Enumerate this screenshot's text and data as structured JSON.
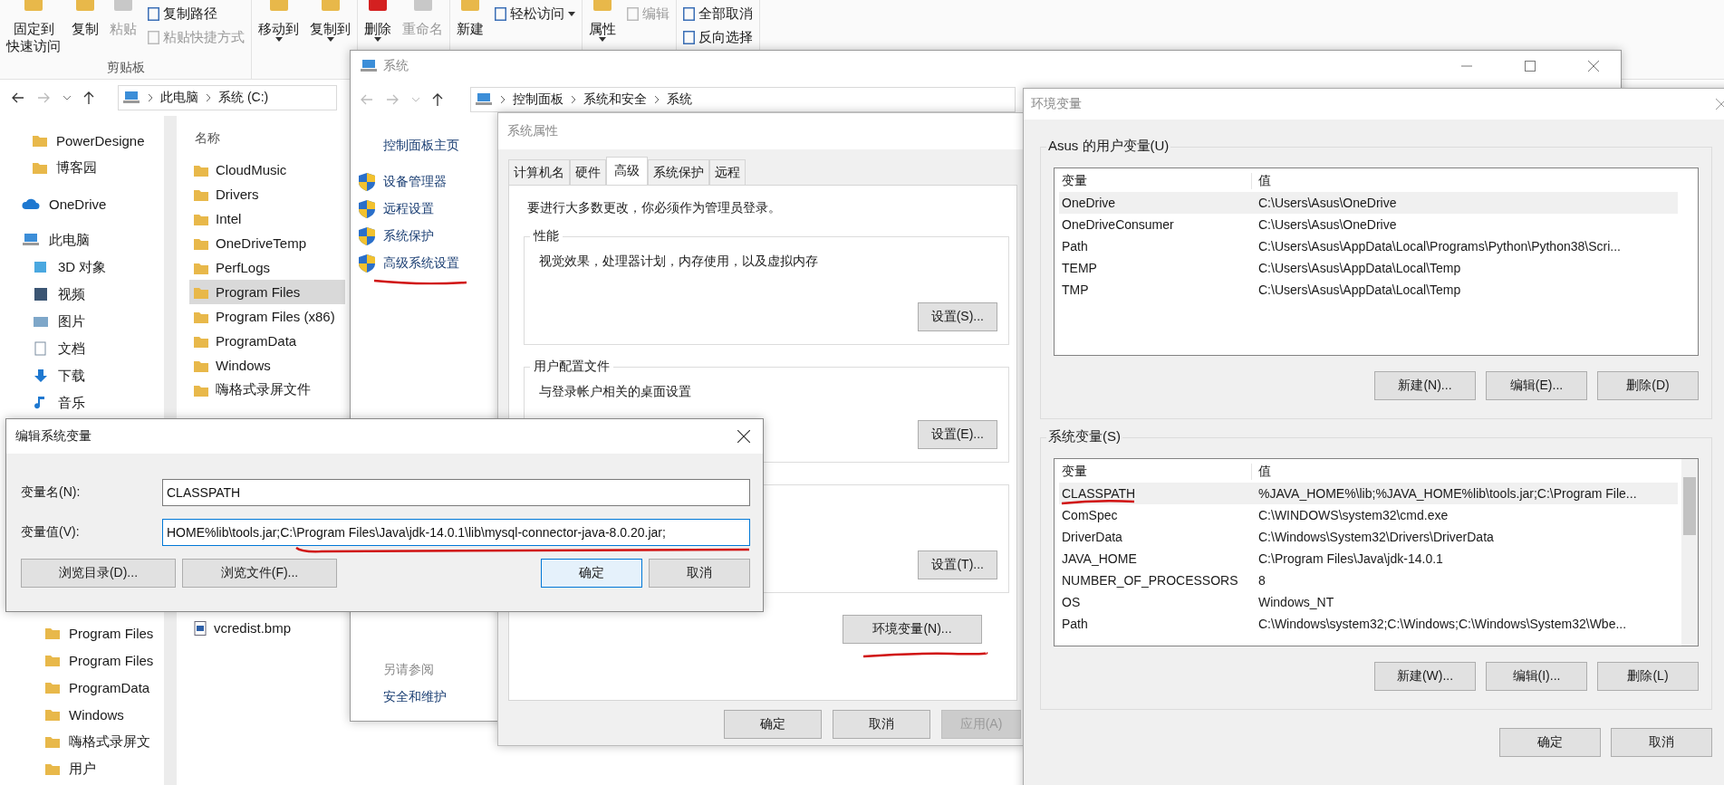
{
  "explorer": {
    "ribbon": {
      "groups": [
        {
          "label": "剪贴板",
          "items": [
            {
              "kind": "large",
              "lines": [
                "固定到",
                "快速访问"
              ],
              "disabled": false,
              "dropdown": false
            },
            {
              "kind": "large",
              "lines": [
                "复制"
              ],
              "disabled": false,
              "dropdown": false
            },
            {
              "kind": "large",
              "lines": [
                "粘贴"
              ],
              "disabled": true,
              "dropdown": false
            },
            {
              "kind": "small",
              "lines": [
                "复制路径"
              ],
              "disabled": false,
              "dropdown": false
            },
            {
              "kind": "small",
              "lines": [
                "粘贴快捷方式"
              ],
              "disabled": true,
              "dropdown": false
            }
          ]
        },
        {
          "items": [
            {
              "kind": "large",
              "lines": [
                "移动到"
              ],
              "disabled": false,
              "dropdown": true
            },
            {
              "kind": "large",
              "lines": [
                "复制到"
              ],
              "disabled": false,
              "dropdown": true
            }
          ]
        },
        {
          "items": [
            {
              "kind": "large",
              "lines": [
                "删除"
              ],
              "disabled": false,
              "dropdown": true
            },
            {
              "kind": "large",
              "lines": [
                "重命名"
              ],
              "disabled": true,
              "dropdown": false
            }
          ]
        },
        {
          "items": [
            {
              "kind": "large",
              "lines": [
                "新建"
              ],
              "disabled": false,
              "dropdown": false
            },
            {
              "kind": "small",
              "lines": [
                "轻松访问"
              ],
              "disabled": false,
              "dropdown": true
            }
          ]
        },
        {
          "items": [
            {
              "kind": "large",
              "lines": [
                "属性"
              ],
              "disabled": false,
              "dropdown": true
            },
            {
              "kind": "small",
              "lines": [
                "编辑"
              ],
              "disabled": true,
              "dropdown": false
            }
          ]
        },
        {
          "items": [
            {
              "kind": "small",
              "lines": [
                "全部取消"
              ],
              "disabled": false,
              "dropdown": false
            },
            {
              "kind": "small",
              "lines": [
                "反向选择"
              ],
              "disabled": false,
              "dropdown": false
            }
          ]
        }
      ]
    },
    "address": [
      "此电脑",
      "系统 (C:)"
    ],
    "quick_access": [
      "PowerDesigne",
      "博客园"
    ],
    "onedrive": "OneDrive",
    "this_pc": {
      "label": "此电脑",
      "children": [
        "3D 对象",
        "视频",
        "图片",
        "文档",
        "下载",
        "音乐"
      ]
    },
    "drive_folders": [
      "Program Files",
      "Program Files",
      "ProgramData",
      "Windows",
      "嗨格式录屏文",
      "用户"
    ],
    "column_header": "名称",
    "files_top": [
      {
        "label": "CloudMusic",
        "selected": false
      },
      {
        "label": "Drivers",
        "selected": false
      },
      {
        "label": "Intel",
        "selected": false
      },
      {
        "label": "OneDriveTemp",
        "selected": false
      },
      {
        "label": "PerfLogs",
        "selected": false
      },
      {
        "label": "Program Files",
        "selected": true
      },
      {
        "label": "Program Files (x86)",
        "selected": false
      },
      {
        "label": "ProgramData",
        "selected": false
      },
      {
        "label": "Windows",
        "selected": false
      },
      {
        "label": "嗨格式录屏文件",
        "selected": false
      }
    ],
    "files_bottom": [
      {
        "label": "vcredist.bmp",
        "selected": false
      }
    ]
  },
  "system_window": {
    "title": "系统",
    "address": [
      "控制面板",
      "系统和安全",
      "系统"
    ],
    "home_link": "控制面板主页",
    "tasks": [
      "设备管理器",
      "远程设置",
      "系统保护",
      "高级系统设置"
    ],
    "see_also": {
      "heading": "另请参阅",
      "links": [
        "安全和维护"
      ]
    }
  },
  "system_properties": {
    "title": "系统属性",
    "tabs": [
      {
        "label": "计算机名",
        "selected": false
      },
      {
        "label": "硬件",
        "selected": false
      },
      {
        "label": "高级",
        "selected": true
      },
      {
        "label": "系统保护",
        "selected": false
      },
      {
        "label": "远程",
        "selected": false
      }
    ],
    "notice": "要进行大多数更改，你必须作为管理员登录。",
    "groups": [
      {
        "title": "性能",
        "description": "视觉效果，处理器计划，内存使用，以及虚拟内存",
        "button": "设置(S)..."
      },
      {
        "title": "用户配置文件",
        "description": "与登录帐户相关的桌面设置",
        "button": "设置(E)..."
      },
      {
        "button": "设置(T)..."
      }
    ],
    "env_button": "环境变量(N)...",
    "buttons": [
      {
        "label": "确定",
        "disabled": false
      },
      {
        "label": "取消",
        "disabled": false
      },
      {
        "label": "应用(A)",
        "disabled": true
      }
    ]
  },
  "env_window": {
    "title": "环境变量",
    "user_vars": {
      "title": "Asus 的用户变量(U)",
      "columns": [
        "变量",
        "值"
      ],
      "rows": [
        {
          "name": "OneDrive",
          "value": "C:\\Users\\Asus\\OneDrive",
          "selected": true
        },
        {
          "name": "OneDriveConsumer",
          "value": "C:\\Users\\Asus\\OneDrive",
          "selected": false
        },
        {
          "name": "Path",
          "value": "C:\\Users\\Asus\\AppData\\Local\\Programs\\Python\\Python38\\Scri...",
          "selected": false
        },
        {
          "name": "TEMP",
          "value": "C:\\Users\\Asus\\AppData\\Local\\Temp",
          "selected": false
        },
        {
          "name": "TMP",
          "value": "C:\\Users\\Asus\\AppData\\Local\\Temp",
          "selected": false
        }
      ],
      "buttons": [
        "新建(N)...",
        "编辑(E)...",
        "删除(D)"
      ]
    },
    "system_vars": {
      "title": "系统变量(S)",
      "columns": [
        "变量",
        "值"
      ],
      "rows": [
        {
          "name": "CLASSPATH",
          "value": "%JAVA_HOME%\\lib;%JAVA_HOME%lib\\tools.jar;C:\\Program File...",
          "selected": true
        },
        {
          "name": "ComSpec",
          "value": "C:\\WINDOWS\\system32\\cmd.exe",
          "selected": false
        },
        {
          "name": "DriverData",
          "value": "C:\\Windows\\System32\\Drivers\\DriverData",
          "selected": false
        },
        {
          "name": "JAVA_HOME",
          "value": "C:\\Program Files\\Java\\jdk-14.0.1",
          "selected": false
        },
        {
          "name": "NUMBER_OF_PROCESSORS",
          "value": "8",
          "selected": false
        },
        {
          "name": "OS",
          "value": "Windows_NT",
          "selected": false
        },
        {
          "name": "Path",
          "value": "C:\\Windows\\system32;C:\\Windows;C:\\Windows\\System32\\Wbe...",
          "selected": false
        }
      ],
      "buttons": [
        "新建(W)...",
        "编辑(I)...",
        "删除(L)"
      ]
    },
    "buttons": [
      "确定",
      "取消"
    ]
  },
  "edit_dialog": {
    "title": "编辑系统变量",
    "name_label": "变量名(N):",
    "name_value": "CLASSPATH",
    "value_label": "变量值(V):",
    "value_value": "HOME%lib\\tools.jar;C:\\Program Files\\Java\\jdk-14.0.1\\lib\\mysql-connector-java-8.0.20.jar;",
    "buttons": [
      {
        "label": "浏览目录(D)...",
        "default": false
      },
      {
        "label": "浏览文件(F)...",
        "default": false
      },
      {
        "label": "确定",
        "default": true
      },
      {
        "label": "取消",
        "default": false
      }
    ]
  }
}
